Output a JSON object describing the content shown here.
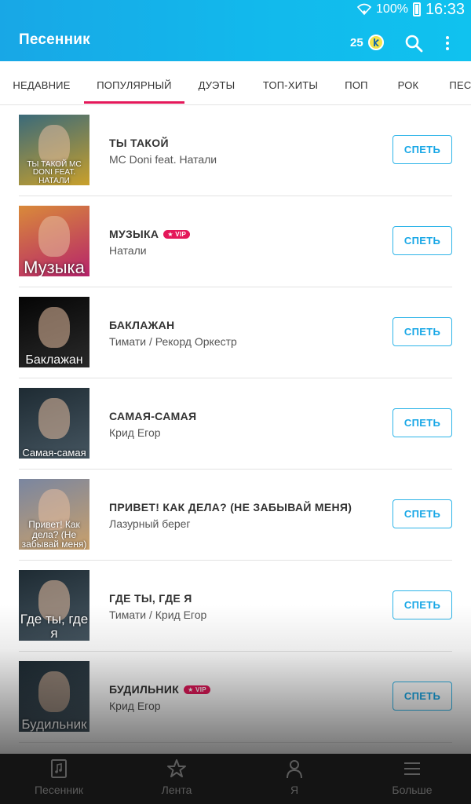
{
  "status": {
    "battery": "100%",
    "time": "16:33"
  },
  "appbar": {
    "title": "Песенник",
    "coins": "25"
  },
  "tabs": [
    {
      "label": "НЕДАВНИЕ"
    },
    {
      "label": "ПОПУЛЯРНЫЙ"
    },
    {
      "label": "ДУЭТЫ"
    },
    {
      "label": "ТОП-ХИТЫ"
    },
    {
      "label": "ПОП"
    },
    {
      "label": "РОК"
    },
    {
      "label": "ПЕСНИ"
    }
  ],
  "vip_label": "★ VIP",
  "songs": [
    {
      "title": "ТЫ ТАКОЙ",
      "artist": "MC Doni feat. Натали",
      "cover_text": "ТЫ ТАКОЙ MC DONI FEAT. НАТАЛИ",
      "vip": false,
      "button": "СПЕТЬ",
      "cover_colors": [
        "#3a6a7a",
        "#c9a02b"
      ]
    },
    {
      "title": "МУЗЫКА",
      "artist": "Натали",
      "cover_text": "Музыка",
      "vip": true,
      "button": "СПЕТЬ",
      "cover_colors": [
        "#d98a3a",
        "#b6236b"
      ]
    },
    {
      "title": "БАКЛАЖАН",
      "artist": "Тимати / Рекорд Оркестр",
      "cover_text": "Баклажан",
      "vip": false,
      "button": "СПЕТЬ",
      "cover_colors": [
        "#050505",
        "#2a2a2a"
      ]
    },
    {
      "title": "САМАЯ-САМАЯ",
      "artist": "Крид Егор",
      "cover_text": "Самая-самая",
      "vip": false,
      "button": "СПЕТЬ",
      "cover_colors": [
        "#1e2b33",
        "#455560"
      ]
    },
    {
      "title": "ПРИВЕТ! КАК ДЕЛА? (НЕ ЗАБЫВАЙ МЕНЯ)",
      "artist": "Лазурный берег",
      "cover_text": "Привет! Как дела? (Не забывай меня)",
      "vip": false,
      "button": "СПЕТЬ",
      "cover_colors": [
        "#7a86a0",
        "#c9a06b"
      ]
    },
    {
      "title": "ГДЕ ТЫ, ГДЕ Я",
      "artist": "Тимати / Крид Егор",
      "cover_text": "Где ты, где я",
      "vip": false,
      "button": "СПЕТЬ",
      "cover_colors": [
        "#1e2b33",
        "#455560"
      ]
    },
    {
      "title": "БУДИЛЬНИК",
      "artist": "Крид Егор",
      "cover_text": "Будильник",
      "vip": true,
      "button": "СПЕТЬ",
      "cover_colors": [
        "#1e2b33",
        "#455560"
      ]
    }
  ],
  "bottom_nav": [
    {
      "label": "Песенник",
      "icon": "songbook-icon"
    },
    {
      "label": "Лента",
      "icon": "star-icon"
    },
    {
      "label": "Я",
      "icon": "person-icon"
    },
    {
      "label": "Больше",
      "icon": "menu-icon"
    }
  ],
  "colors": {
    "accent": "#18a7e6",
    "tab_indicator": "#e4185a",
    "vip": "#e4185a"
  }
}
